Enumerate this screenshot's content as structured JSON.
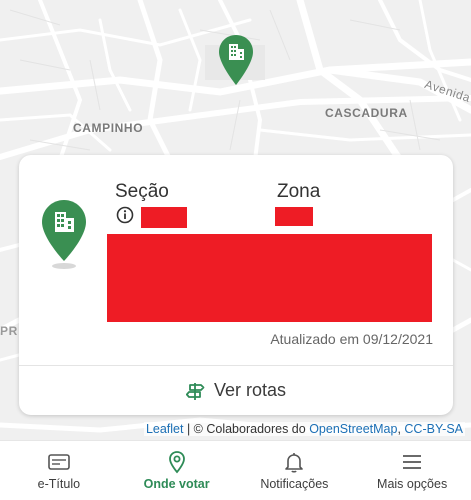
{
  "colors": {
    "accent": "#2e8b57",
    "pin": "#3a8f52",
    "redacted": "#ee1c25",
    "link": "#1b6fb5"
  },
  "map": {
    "labels": {
      "campinho": "CAMPINHO",
      "cascadura": "CASCADURA",
      "avenida": "Avenida",
      "pr": "PR"
    },
    "marker_icon": "building-pin-icon"
  },
  "card": {
    "secao_label": "Seção",
    "zona_label": "Zona",
    "info_icon": "info-icon",
    "updated_text": "Atualizado em 09/12/2021",
    "routes_label": "Ver rotas",
    "routes_icon": "signpost-icon"
  },
  "attribution": {
    "leaflet": "Leaflet",
    "separator": " | © Colaboradores do ",
    "osm": "OpenStreetMap",
    "comma": ", ",
    "license": "CC-BY-SA"
  },
  "nav": {
    "items": [
      {
        "label": "e-Título",
        "icon": "card-icon"
      },
      {
        "label": "Onde votar",
        "icon": "location-pin-icon"
      },
      {
        "label": "Notificações",
        "icon": "bell-icon"
      },
      {
        "label": "Mais opções",
        "icon": "menu-icon"
      }
    ],
    "active_index": 1
  }
}
